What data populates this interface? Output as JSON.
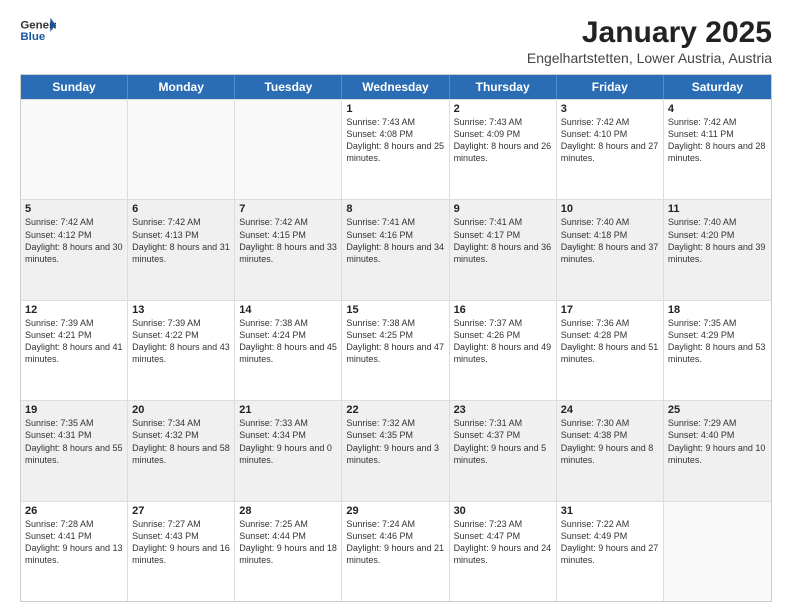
{
  "logo": {
    "general": "General",
    "blue": "Blue"
  },
  "title": "January 2025",
  "subtitle": "Engelhartstetten, Lower Austria, Austria",
  "headers": [
    "Sunday",
    "Monday",
    "Tuesday",
    "Wednesday",
    "Thursday",
    "Friday",
    "Saturday"
  ],
  "weeks": [
    [
      {
        "day": "",
        "info": "",
        "empty": true
      },
      {
        "day": "",
        "info": "",
        "empty": true
      },
      {
        "day": "",
        "info": "",
        "empty": true
      },
      {
        "day": "1",
        "info": "Sunrise: 7:43 AM\nSunset: 4:08 PM\nDaylight: 8 hours and 25 minutes."
      },
      {
        "day": "2",
        "info": "Sunrise: 7:43 AM\nSunset: 4:09 PM\nDaylight: 8 hours and 26 minutes."
      },
      {
        "day": "3",
        "info": "Sunrise: 7:42 AM\nSunset: 4:10 PM\nDaylight: 8 hours and 27 minutes."
      },
      {
        "day": "4",
        "info": "Sunrise: 7:42 AM\nSunset: 4:11 PM\nDaylight: 8 hours and 28 minutes."
      }
    ],
    [
      {
        "day": "5",
        "info": "Sunrise: 7:42 AM\nSunset: 4:12 PM\nDaylight: 8 hours and 30 minutes.",
        "shaded": true
      },
      {
        "day": "6",
        "info": "Sunrise: 7:42 AM\nSunset: 4:13 PM\nDaylight: 8 hours and 31 minutes.",
        "shaded": true
      },
      {
        "day": "7",
        "info": "Sunrise: 7:42 AM\nSunset: 4:15 PM\nDaylight: 8 hours and 33 minutes.",
        "shaded": true
      },
      {
        "day": "8",
        "info": "Sunrise: 7:41 AM\nSunset: 4:16 PM\nDaylight: 8 hours and 34 minutes.",
        "shaded": true
      },
      {
        "day": "9",
        "info": "Sunrise: 7:41 AM\nSunset: 4:17 PM\nDaylight: 8 hours and 36 minutes.",
        "shaded": true
      },
      {
        "day": "10",
        "info": "Sunrise: 7:40 AM\nSunset: 4:18 PM\nDaylight: 8 hours and 37 minutes.",
        "shaded": true
      },
      {
        "day": "11",
        "info": "Sunrise: 7:40 AM\nSunset: 4:20 PM\nDaylight: 8 hours and 39 minutes.",
        "shaded": true
      }
    ],
    [
      {
        "day": "12",
        "info": "Sunrise: 7:39 AM\nSunset: 4:21 PM\nDaylight: 8 hours and 41 minutes."
      },
      {
        "day": "13",
        "info": "Sunrise: 7:39 AM\nSunset: 4:22 PM\nDaylight: 8 hours and 43 minutes."
      },
      {
        "day": "14",
        "info": "Sunrise: 7:38 AM\nSunset: 4:24 PM\nDaylight: 8 hours and 45 minutes."
      },
      {
        "day": "15",
        "info": "Sunrise: 7:38 AM\nSunset: 4:25 PM\nDaylight: 8 hours and 47 minutes."
      },
      {
        "day": "16",
        "info": "Sunrise: 7:37 AM\nSunset: 4:26 PM\nDaylight: 8 hours and 49 minutes."
      },
      {
        "day": "17",
        "info": "Sunrise: 7:36 AM\nSunset: 4:28 PM\nDaylight: 8 hours and 51 minutes."
      },
      {
        "day": "18",
        "info": "Sunrise: 7:35 AM\nSunset: 4:29 PM\nDaylight: 8 hours and 53 minutes."
      }
    ],
    [
      {
        "day": "19",
        "info": "Sunrise: 7:35 AM\nSunset: 4:31 PM\nDaylight: 8 hours and 55 minutes.",
        "shaded": true
      },
      {
        "day": "20",
        "info": "Sunrise: 7:34 AM\nSunset: 4:32 PM\nDaylight: 8 hours and 58 minutes.",
        "shaded": true
      },
      {
        "day": "21",
        "info": "Sunrise: 7:33 AM\nSunset: 4:34 PM\nDaylight: 9 hours and 0 minutes.",
        "shaded": true
      },
      {
        "day": "22",
        "info": "Sunrise: 7:32 AM\nSunset: 4:35 PM\nDaylight: 9 hours and 3 minutes.",
        "shaded": true
      },
      {
        "day": "23",
        "info": "Sunrise: 7:31 AM\nSunset: 4:37 PM\nDaylight: 9 hours and 5 minutes.",
        "shaded": true
      },
      {
        "day": "24",
        "info": "Sunrise: 7:30 AM\nSunset: 4:38 PM\nDaylight: 9 hours and 8 minutes.",
        "shaded": true
      },
      {
        "day": "25",
        "info": "Sunrise: 7:29 AM\nSunset: 4:40 PM\nDaylight: 9 hours and 10 minutes.",
        "shaded": true
      }
    ],
    [
      {
        "day": "26",
        "info": "Sunrise: 7:28 AM\nSunset: 4:41 PM\nDaylight: 9 hours and 13 minutes."
      },
      {
        "day": "27",
        "info": "Sunrise: 7:27 AM\nSunset: 4:43 PM\nDaylight: 9 hours and 16 minutes."
      },
      {
        "day": "28",
        "info": "Sunrise: 7:25 AM\nSunset: 4:44 PM\nDaylight: 9 hours and 18 minutes."
      },
      {
        "day": "29",
        "info": "Sunrise: 7:24 AM\nSunset: 4:46 PM\nDaylight: 9 hours and 21 minutes."
      },
      {
        "day": "30",
        "info": "Sunrise: 7:23 AM\nSunset: 4:47 PM\nDaylight: 9 hours and 24 minutes."
      },
      {
        "day": "31",
        "info": "Sunrise: 7:22 AM\nSunset: 4:49 PM\nDaylight: 9 hours and 27 minutes."
      },
      {
        "day": "",
        "info": "",
        "empty": true
      }
    ]
  ]
}
